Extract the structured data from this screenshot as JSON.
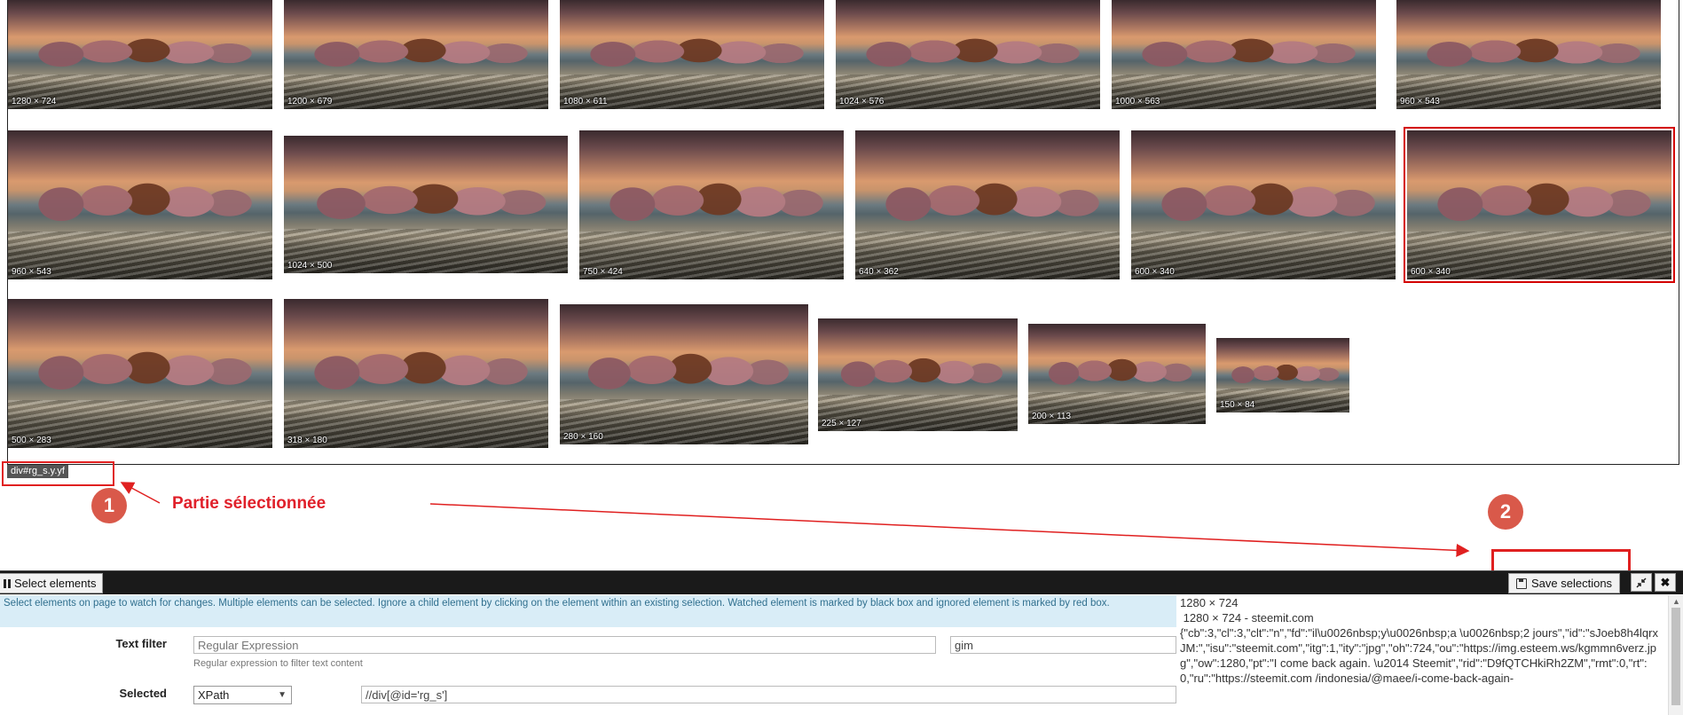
{
  "grid": {
    "images": [
      {
        "dim": "1280 × 724"
      },
      {
        "dim": "1200 × 679"
      },
      {
        "dim": "1080 × 611"
      },
      {
        "dim": "1024 × 576"
      },
      {
        "dim": "1000 × 563"
      },
      {
        "dim": "960 × 543"
      },
      {
        "dim": "960 × 543"
      },
      {
        "dim": "1024 × 500"
      },
      {
        "dim": "750 × 424"
      },
      {
        "dim": "640 × 362"
      },
      {
        "dim": "600 × 340"
      },
      {
        "dim": "600 × 340",
        "selected": true
      },
      {
        "dim": "500 × 283"
      },
      {
        "dim": "318 × 180"
      },
      {
        "dim": "280 × 160"
      },
      {
        "dim": "225 × 127"
      },
      {
        "dim": "200 × 113"
      },
      {
        "dim": "150 × 84"
      }
    ],
    "selection_tag": "div#rg_s.y.yf"
  },
  "annotations": {
    "step1": "1",
    "step2": "2",
    "caption": "Partie sélectionnée",
    "color": "#e02020"
  },
  "panel": {
    "tab_label": "Select elements",
    "save_label": "Save selections",
    "shrink_icon": "shrink-icon",
    "close_icon": "close-icon",
    "info": "Select elements on page to watch for changes. Multiple elements can be selected. Ignore a child element by clicking on the element within an existing selection. Watched element is marked by black box and ignored element is marked by red box.",
    "text_filter": {
      "label": "Text filter",
      "placeholder": "Regular Expression",
      "flags": "gim",
      "hint": "Regular expression to filter text content"
    },
    "selected": {
      "label": "Selected",
      "type": "XPath",
      "value": "//div[@id='rg_s']"
    },
    "preview": {
      "line1": "1280 × 724",
      "line2": " 1280 × 724 - steemit.com",
      "line3": "{\"cb\":3,\"cl\":3,\"clt\":\"n\",\"fd\":\"il\\u0026nbsp;y\\u0026nbsp;a \\u0026nbsp;2 jours\",\"id\":\"sJoeb8h4lqrxJM:\",\"isu\":\"steemit.com\",\"itg\":1,\"ity\":\"jpg\",\"oh\":724,\"ou\":\"https://img.esteem.ws/kgmmn6verz.jpg\",\"ow\":1280,\"pt\":\"I come back again. \\u2014 Steemit\",\"rid\":\"D9fQTCHkiRh2ZM\",\"rmt\":0,\"rt\":0,\"ru\":\"https://steemit.com /indonesia/@maee/i-come-back-again-"
    }
  }
}
